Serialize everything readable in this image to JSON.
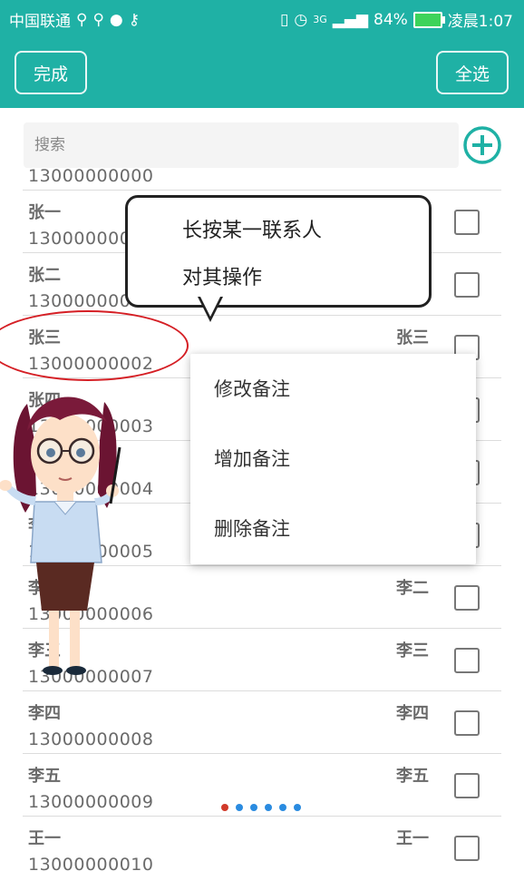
{
  "status_bar": {
    "carrier": "中国联通",
    "battery": "84%",
    "network": "3G",
    "time": "凌晨1:07"
  },
  "topbar": {
    "done_label": "完成",
    "select_all_label": "全选"
  },
  "search": {
    "placeholder": "搜索"
  },
  "contacts": [
    {
      "name": "张一",
      "phone": "13000000000",
      "right": ""
    },
    {
      "name": "张二",
      "phone": "13000000001",
      "right": ""
    },
    {
      "name": "张三",
      "phone": "13000000002",
      "right": "张三"
    },
    {
      "name": "张四",
      "phone": "13000000003",
      "right": ""
    },
    {
      "name": "李一",
      "phone": "13000000004",
      "right": ""
    },
    {
      "name": "李一",
      "phone": "13000000005",
      "right": ""
    },
    {
      "name": "李二",
      "phone": "13000000006",
      "right": "李二"
    },
    {
      "name": "李三",
      "phone": "13000000007",
      "right": "李三"
    },
    {
      "name": "李四",
      "phone": "13000000008",
      "right": "李四"
    },
    {
      "name": "李五",
      "phone": "13000000009",
      "right": "李五"
    },
    {
      "name": "王一",
      "phone": "13000000010",
      "right": "王一"
    }
  ],
  "context_menu": {
    "items": [
      "修改备注",
      "增加备注",
      "删除备注"
    ]
  },
  "tooltip": {
    "line1": "长按某一联系人",
    "line2": "对其操作"
  },
  "colors": {
    "primary": "#1fb1a5",
    "highlight_ring": "#d51f25"
  },
  "icons": {
    "add": "plus-circle-icon",
    "checkbox": "checkbox-icon"
  }
}
